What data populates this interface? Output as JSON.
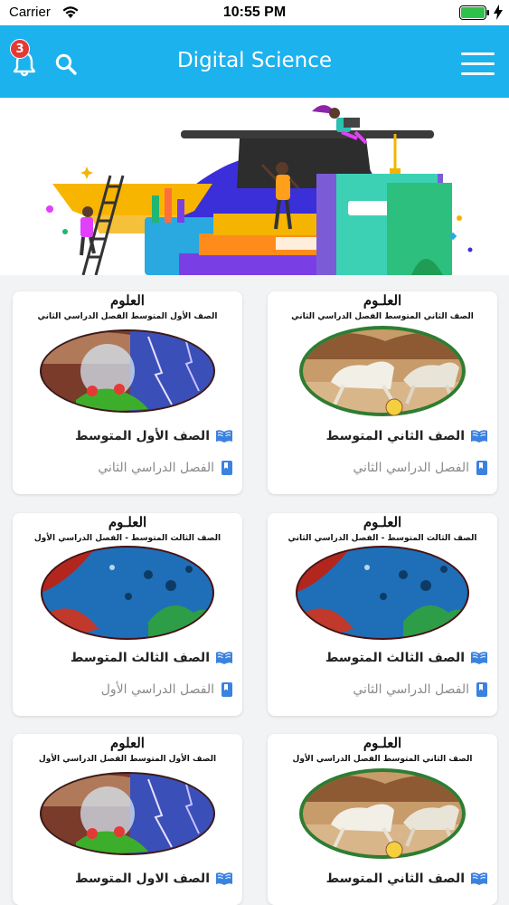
{
  "status_bar": {
    "carrier": "Carrier",
    "time": "10:55 PM"
  },
  "header": {
    "title": "Digital Science",
    "notification_count": "3",
    "colors": {
      "bar": "#1bb2ee",
      "badge": "#e53935"
    }
  },
  "books": [
    {
      "grade": "الصف الثاني المتوسط",
      "term": "الفصل الدراسي الثاني",
      "cover_title": "العلـوم",
      "cover_subtitle": "الصف الثاني المتوسط الفصل الدراسي الثاني",
      "cover_image": "horses"
    },
    {
      "grade": "الصف الأول المتوسط",
      "term": "الفصل الدراسي الثاني",
      "cover_title": "العلوم",
      "cover_subtitle": "الصف الأول المتوسط الفصل الدراسي الثاني",
      "cover_image": "frog"
    },
    {
      "grade": "الصف الثالث المتوسط",
      "term": "الفصل الدراسي الثاني",
      "cover_title": "العلـوم",
      "cover_subtitle": "الصف الثالث المتوسط - الفصل الدراسي الثاني",
      "cover_image": "reef"
    },
    {
      "grade": "الصف الثالث المتوسط",
      "term": "الفصل الدراسي الأول",
      "cover_title": "العلـوم",
      "cover_subtitle": "الصف الثالث المتوسط - الفصل الدراسي الأول",
      "cover_image": "reef"
    },
    {
      "grade": "الصف الثاني المتوسط",
      "term": "",
      "cover_title": "العلـوم",
      "cover_subtitle": "الصف الثاني المتوسط الفصل الدراسي الأول",
      "cover_image": "horses"
    },
    {
      "grade": "الصف الاول المتوسط",
      "term": "",
      "cover_title": "العلوم",
      "cover_subtitle": "الصف الأول المتوسط الفصل الدراسي الأول",
      "cover_image": "frog"
    }
  ],
  "icons": {
    "book_open": "book-open-icon",
    "bookmark": "bookmark-icon",
    "accent": "#3b82e0"
  }
}
